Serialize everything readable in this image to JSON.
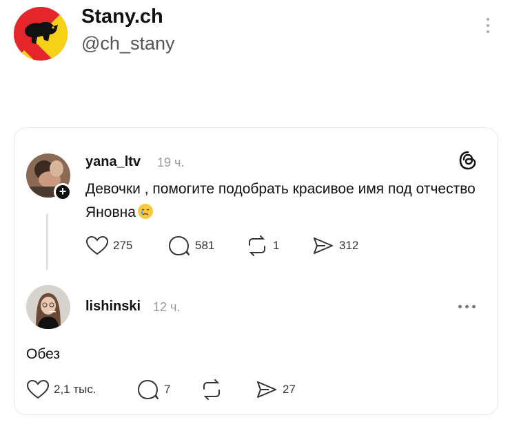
{
  "header": {
    "account_name": "Stany.ch",
    "account_handle": "@ch_stany",
    "avatar_icon": "bern-bear-flag-icon",
    "brand_colors": {
      "red": "#E3262B",
      "yellow": "#F7D117",
      "black": "#111111"
    }
  },
  "post": {
    "username": "yana_ltv",
    "time": "19 ч.",
    "text": "Девочки , помогите подобрать красивое имя под отчество Яновна",
    "emoji_icon": "crying-face-emoji-icon",
    "follow_badge": "+",
    "actions": {
      "likes": "275",
      "replies": "581",
      "reposts": "1",
      "shares": "312"
    }
  },
  "reply": {
    "username": "lishinski",
    "time": "12 ч.",
    "text": "Обез",
    "actions": {
      "likes": "2,1 тыс.",
      "replies": "7",
      "shares": "27"
    }
  }
}
